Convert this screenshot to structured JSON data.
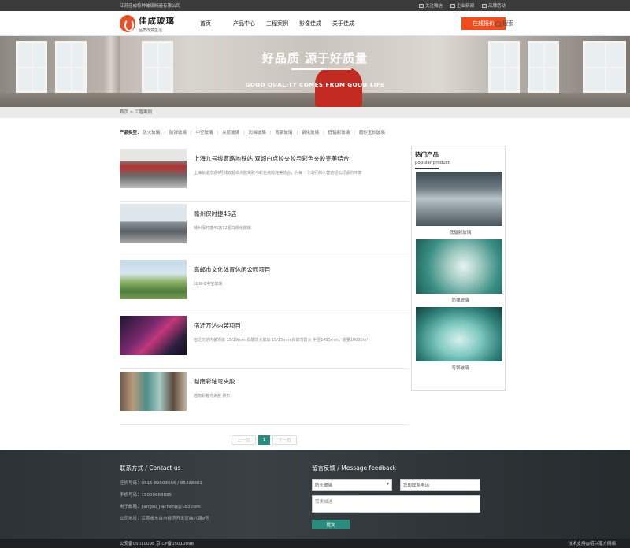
{
  "topbar": {
    "company": "江苏佳成特种玻璃制造有限公司",
    "links": [
      "关注微信",
      "企业新闻",
      "品牌活动"
    ]
  },
  "header": {
    "logo_cn": "佳成玻璃",
    "logo_sub": "品质改变生活",
    "nav": [
      "首页",
      "产品中心",
      "工程案例",
      "影像佳成",
      "关于佳成"
    ],
    "quote_button": "在线报价",
    "search_label": "搜索"
  },
  "banner": {
    "title": "好品质 源于好质量",
    "subtitle": "GOOD QUALITY COMES FROM GOOD LIFE"
  },
  "breadcrumb": "首页 > 工程案例",
  "filter": {
    "label": "产品类型：",
    "options": [
      "防火玻璃",
      "防弹玻璃",
      "中空玻璃",
      "夹层玻璃",
      "彩釉玻璃",
      "弯钢玻璃",
      "钢化玻璃",
      "低辐射玻璃",
      "磨砂玉砂玻璃"
    ]
  },
  "cases": [
    {
      "title": "上海九号线曹路地铁站,双超白点胶夹胶与彩色夹胶完美结合",
      "desc": "上海轨道交通9号线双超白点胶夹胶与彩色夹胶完美结合，为每一个出行的人营造轻松舒适的环境"
    },
    {
      "title": "赣州保时捷4S店",
      "desc": "赣州保时捷4S店12超白钢化玻璃"
    },
    {
      "title": "高邮市文化体育休闲公园项目",
      "desc": "LOW-E中空玻璃"
    },
    {
      "title": "宿迁万达内装项目",
      "desc": "宿迁万达内装项目 15/19mm 白玻防火玻璃 15/15mm 白玻弯防火 半径1495mm，总量10000m²"
    },
    {
      "title": "越南彩釉弯夹胶",
      "desc": "越南彩釉弯夹胶 拱形"
    }
  ],
  "sidebar": {
    "title": "热门产品",
    "subtitle": "popular product",
    "products": [
      "低辐射玻璃",
      "防弹玻璃",
      "弯钢玻璃"
    ]
  },
  "pager": {
    "prev": "上一页",
    "current": "1",
    "next": "下一页"
  },
  "footer": {
    "contact_title": "联系方式 / Contact us",
    "contact_rows": [
      "座机号码：0515-89503666 / 85398881",
      "手机号码：15000668885",
      "电子邮箱：jiangsu_jiacheng@163.com",
      "公司地址：江苏省东台市经济开发区纬八路9号"
    ],
    "message_title": "留言反馈 / Message feedback",
    "select_value": "防火玻璃",
    "phone_placeholder": "您的联系电话",
    "desc_placeholder": "需求描述",
    "submit": "提交",
    "icp": "公安备05010098 京ICP备05010098",
    "support": "技术支持@绍兴魔方网络"
  }
}
